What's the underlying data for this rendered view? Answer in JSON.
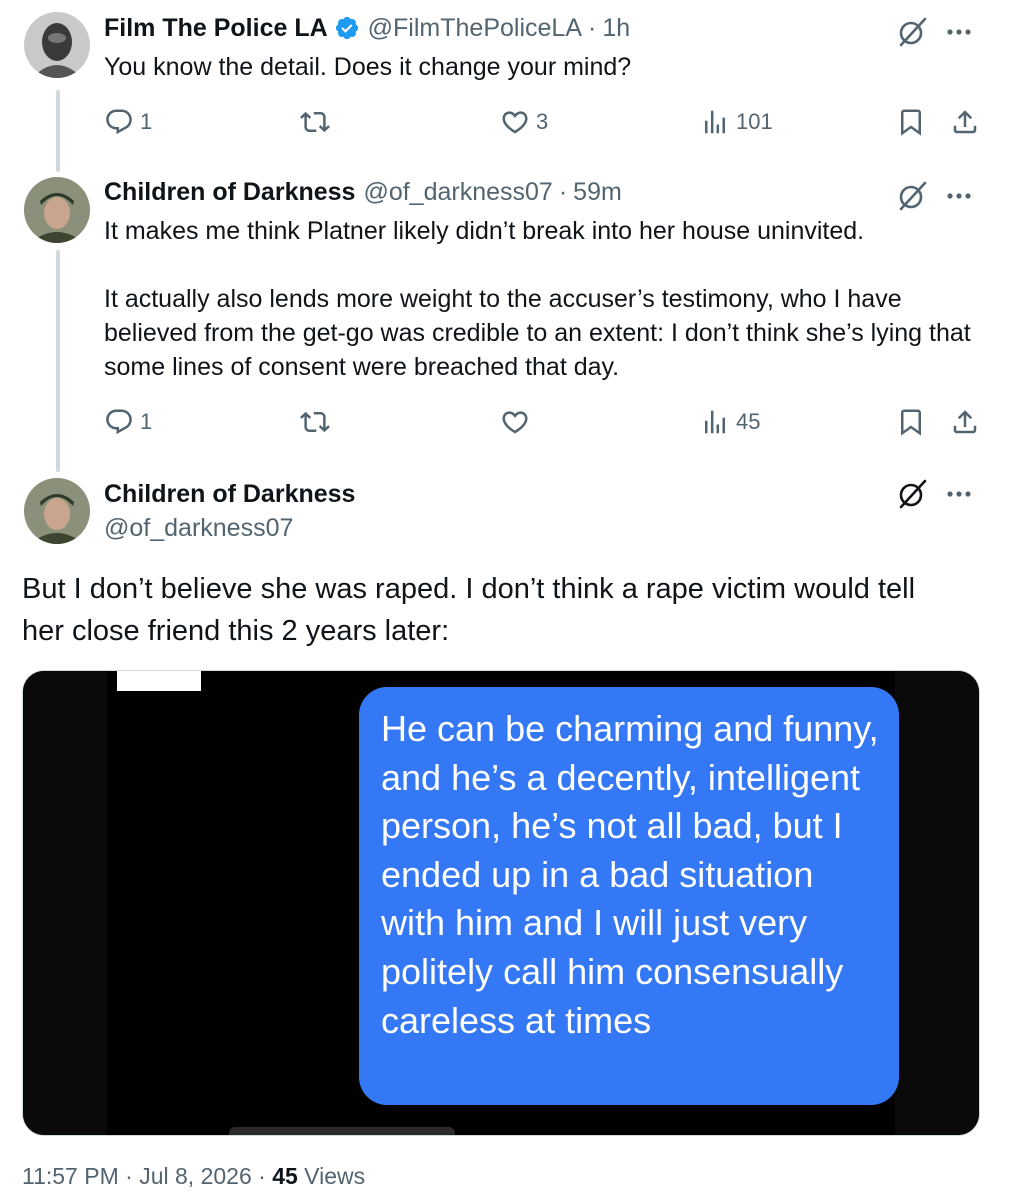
{
  "tweets": [
    {
      "name": "Film The Police LA",
      "handle": "@FilmThePoliceLA",
      "time": "1h",
      "verified": true,
      "text": "You know the detail. Does it change your mind?",
      "actions": {
        "replies": "1",
        "reposts": "",
        "likes": "3",
        "views": "101"
      }
    },
    {
      "name": "Children of Darkness",
      "handle": "@of_darkness07",
      "time": "59m",
      "paragraphs": [
        "It makes me think Platner likely didn’t break into her house uninvited.",
        "It actually also lends more weight to the accuser’s testimony, who I have believed from the get-go was credible to an extent: I don’t think she’s lying that some lines of consent were breached that day."
      ],
      "actions": {
        "replies": "1",
        "reposts": "",
        "likes": "",
        "views": "45"
      }
    }
  ],
  "main_tweet": {
    "name": "Children of Darkness",
    "handle": "@of_darkness07",
    "text_line1": "But I don’t believe she was raped. I don’t think a rape victim would tell",
    "text_line2": "her close friend this 2 years later:",
    "image_bubble_text": "He can be charming and funny, and he’s a decently, intelligent person, he’s not all bad, but I ended up in a bad situation with him and I will just very politely call him consensually careless at times",
    "image_bubble_color": "#3478f6",
    "footer": {
      "time": "11:57 PM",
      "date": "Jul 8, 2026",
      "views_count": "45",
      "views_label": "Views"
    }
  },
  "colors": {
    "text": "#0f1419",
    "secondary": "#536471",
    "verified": "#1d9bf0",
    "thread_line": "#cfd9de"
  },
  "icons": [
    "verified-badge-icon",
    "grok-icon",
    "more-icon",
    "reply-icon",
    "repost-icon",
    "like-icon",
    "views-icon",
    "bookmark-icon",
    "share-icon"
  ]
}
